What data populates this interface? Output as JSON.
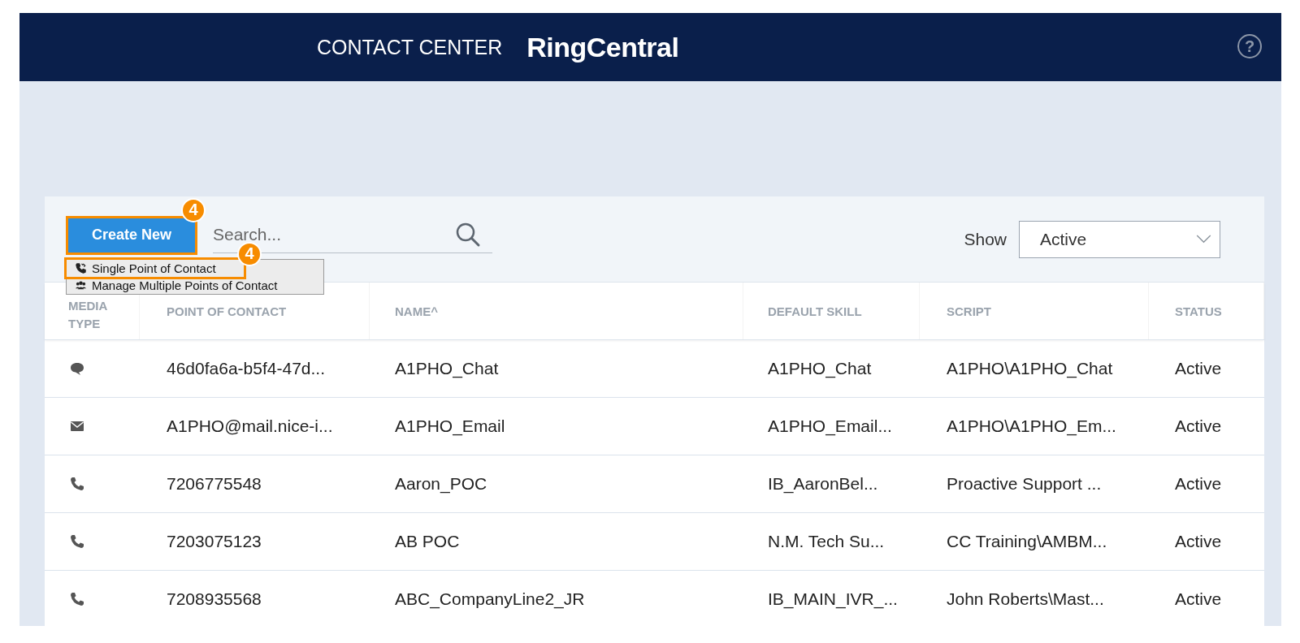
{
  "header": {
    "title": "CONTACT CENTER",
    "logo": "RingCentral",
    "help": "?"
  },
  "toolbar": {
    "create_button": "Create New",
    "search": {
      "placeholder": "Search..."
    },
    "show_label": "Show",
    "show_select": "Active"
  },
  "menu": [
    {
      "label": "Single Point of Contact",
      "kind": "single",
      "highlighted": true
    },
    {
      "label": "Manage Multiple Points of Contact",
      "kind": "multiple",
      "highlighted": false
    }
  ],
  "callouts": [
    {
      "label": "4"
    },
    {
      "label": "4"
    }
  ],
  "table": {
    "columns": [
      {
        "label": "MEDIA TYPE"
      },
      {
        "label": "POINT OF CONTACT"
      },
      {
        "label": "NAME",
        "sort_mark": "^"
      },
      {
        "label": "DEFAULT SKILL"
      },
      {
        "label": "SCRIPT"
      },
      {
        "label": "STATUS"
      }
    ],
    "rows": [
      {
        "kind": "chat",
        "point_of_contact": "46d0fa6a-b5f4-47d...",
        "name": "A1PHO_Chat",
        "default_skill": "A1PHO_Chat",
        "script": "A1PHO\\A1PHO_Chat",
        "status": "Active"
      },
      {
        "kind": "email",
        "point_of_contact": "A1PHO@mail.nice-i...",
        "name": "A1PHO_Email",
        "default_skill": "A1PHO_Email...",
        "script": "A1PHO\\A1PHO_Em...",
        "status": "Active"
      },
      {
        "kind": "phone",
        "point_of_contact": "7206775548",
        "name": "Aaron_POC",
        "default_skill": "IB_AaronBel...",
        "script": "Proactive Support ...",
        "status": "Active"
      },
      {
        "kind": "phone",
        "point_of_contact": "7203075123",
        "name": "AB POC",
        "default_skill": "N.M. Tech Su...",
        "script": "CC Training\\AMBM...",
        "status": "Active"
      },
      {
        "kind": "phone",
        "point_of_contact": "7208935568",
        "name": "ABC_CompanyLine2_JR",
        "default_skill": "IB_MAIN_IVR_...",
        "script": "John Roberts\\Mast...",
        "status": "Active"
      }
    ]
  }
}
